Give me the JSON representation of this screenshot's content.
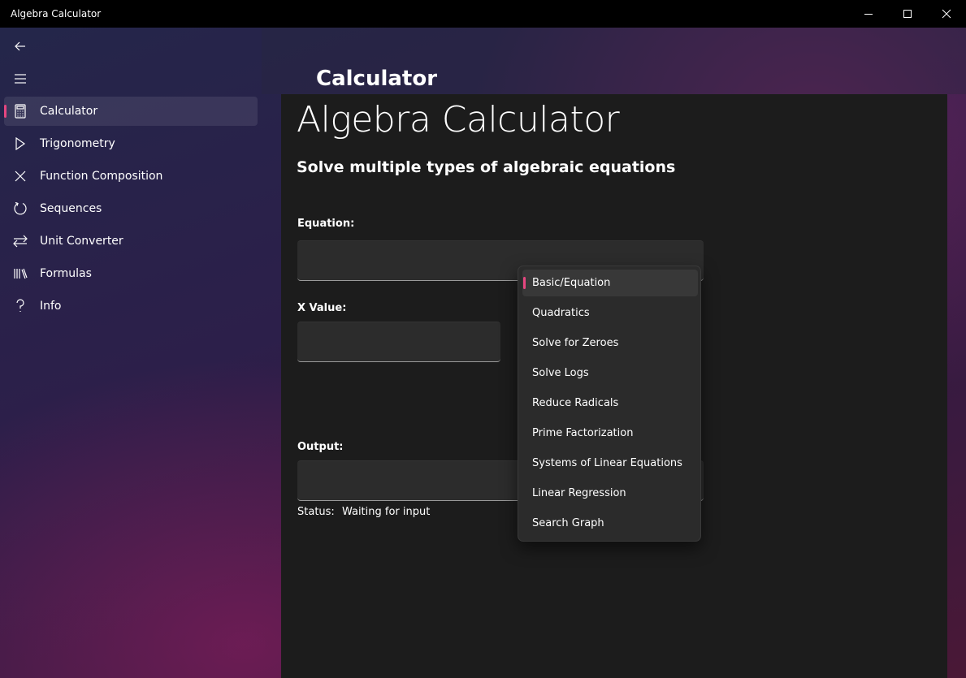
{
  "window": {
    "title": "Algebra Calculator"
  },
  "sidebar": {
    "items": [
      {
        "label": "Calculator",
        "icon": "calculator-icon",
        "selected": true
      },
      {
        "label": "Trigonometry",
        "icon": "play-triangle-icon"
      },
      {
        "label": "Function Composition",
        "icon": "cross-icon"
      },
      {
        "label": "Sequences",
        "icon": "refresh-icon"
      },
      {
        "label": "Unit Converter",
        "icon": "swap-arrows-icon"
      },
      {
        "label": "Formulas",
        "icon": "library-icon"
      },
      {
        "label": "Info",
        "icon": "question-icon"
      }
    ]
  },
  "header": {
    "title": "Calculator"
  },
  "main": {
    "title": "Algebra Calculator",
    "subtitle": "Solve multiple types of algebraic equations",
    "equation_label": "Equation:",
    "equation_value": "",
    "x_value_label": "X Value:",
    "x_value": "",
    "output_label": "Output:",
    "output_value": "",
    "status_label": "Status:",
    "status_value": "Waiting for input"
  },
  "dropdown": {
    "items": [
      {
        "label": "Basic/Equation",
        "selected": true
      },
      {
        "label": "Quadratics"
      },
      {
        "label": "Solve for Zeroes"
      },
      {
        "label": "Solve Logs"
      },
      {
        "label": "Reduce Radicals"
      },
      {
        "label": "Prime Factorization"
      },
      {
        "label": "Systems of Linear Equations"
      },
      {
        "label": "Linear Regression"
      },
      {
        "label": "Search Graph"
      }
    ]
  },
  "colors": {
    "accent": "#e64680",
    "panel": "#1c1c1c",
    "input": "#2c2c2c"
  }
}
